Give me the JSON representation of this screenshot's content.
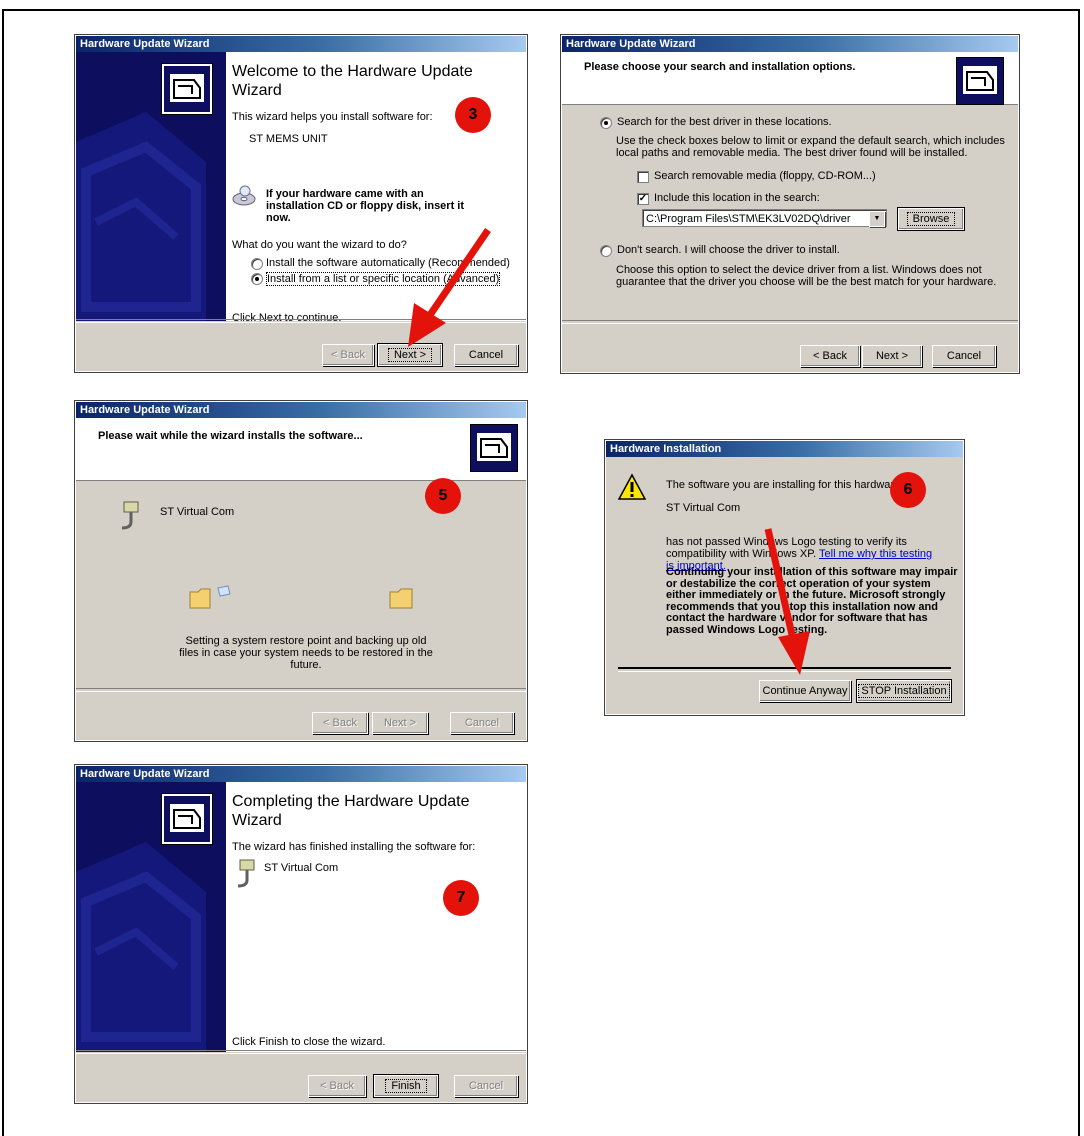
{
  "wizard1": {
    "title": "Hardware Update Wizard",
    "heading": "Welcome to the Hardware Update Wizard",
    "intro": "This wizard helps you install software for:",
    "device": "ST MEMS UNIT",
    "cd_note": "If your hardware came with an installation CD or floppy disk, insert it now.",
    "question": "What do you want the wizard to do?",
    "option_auto": "Install the software automatically (Recommended)",
    "option_list": "Install from a list or specific location (Advanced)",
    "footer": "Click Next to continue.",
    "back": "< Back",
    "next": "Next >",
    "cancel": "Cancel",
    "step": "3"
  },
  "wizard2": {
    "title": "Hardware Update Wizard",
    "header": "Please choose your search and installation options.",
    "option_search": "Search for the best driver in these locations.",
    "search_desc": "Use the check boxes below to limit or expand the default search, which includes local paths and removable media. The best driver found will be installed.",
    "check_removable": "Search removable media (floppy, CD-ROM...)",
    "check_location": "Include this location in the search:",
    "path": "C:\\Program Files\\STM\\EK3LV02DQ\\driver",
    "browse": "Browse",
    "option_dont": "Don't search. I will choose the driver to install.",
    "dont_desc": "Choose this option to select the device driver from a list. Windows does not guarantee that the driver you choose will be the best match for your hardware.",
    "back": "< Back",
    "next": "Next >",
    "cancel": "Cancel"
  },
  "wizard3": {
    "title": "Hardware Update Wizard",
    "header": "Please wait while the wizard installs the software...",
    "device": "ST Virtual Com",
    "status": "Setting a system restore point and backing up old files in case your system needs to be restored in the future.",
    "back": "< Back",
    "next": "Next >",
    "cancel": "Cancel",
    "step": "5"
  },
  "dialog": {
    "title": "Hardware Installation",
    "intro": "The software you are installing for this hardware:",
    "device": "ST Virtual Com",
    "logo_text": "has not passed Windows Logo testing to verify its compatibility with Windows XP.",
    "logo_link": "Tell me why this testing is important.",
    "warning": "Continuing your installation of this software may impair or destabilize the correct operation of your system either immediately or in the future. Microsoft strongly recommends that you stop this installation now and contact the hardware vendor for software that has passed Windows Logo testing.",
    "continue": "Continue Anyway",
    "stop": "STOP Installation",
    "step": "6"
  },
  "wizard4": {
    "title": "Hardware Update Wizard",
    "heading": "Completing the Hardware Update Wizard",
    "intro": "The wizard has finished installing the software for:",
    "device": "ST Virtual Com",
    "footer": "Click Finish to close the wizard.",
    "back": "< Back",
    "finish": "Finish",
    "cancel": "Cancel",
    "step": "7"
  },
  "colors": {
    "titlebar": "#0a246a",
    "face": "#d4d0c8",
    "sidebar": "#0d0f5e",
    "badge": "#e3120b",
    "arrow": "#e3120b"
  }
}
